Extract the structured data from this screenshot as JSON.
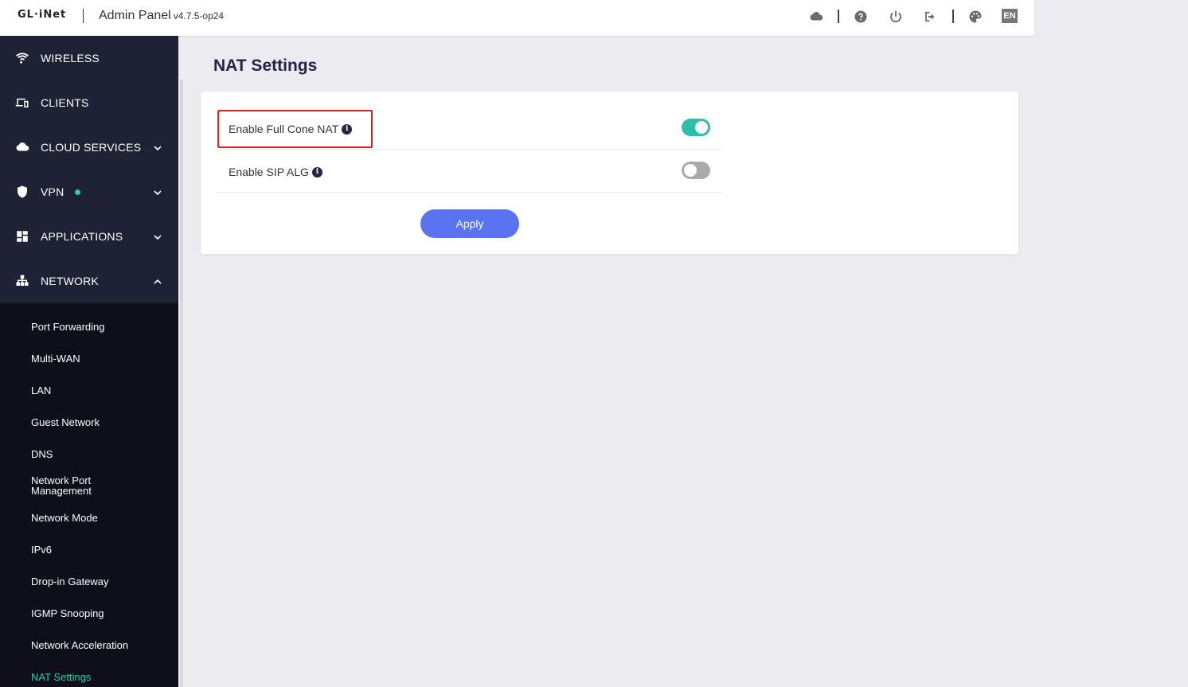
{
  "header": {
    "logo": "GL·iNet",
    "title": "Admin Panel",
    "version": "v4.7.5-op24",
    "language": "EN",
    "icons": [
      "cloud-icon",
      "help-icon",
      "power-icon",
      "logout-icon",
      "palette-icon"
    ]
  },
  "sidebar": {
    "items": [
      {
        "label": "WIRELESS",
        "icon": "wifi-icon"
      },
      {
        "label": "CLIENTS",
        "icon": "devices-icon"
      },
      {
        "label": "CLOUD SERVICES",
        "icon": "cloud-icon"
      },
      {
        "label": "VPN",
        "icon": "shield-icon"
      },
      {
        "label": "APPLICATIONS",
        "icon": "apps-grid-icon"
      },
      {
        "label": "NETWORK",
        "icon": "network-icon"
      }
    ],
    "submenu": [
      "Port Forwarding",
      "Multi-WAN",
      "LAN",
      "Guest Network",
      "DNS",
      "Network Port Management",
      "Network Mode",
      "IPv6",
      "Drop-in Gateway",
      "IGMP Snooping",
      "Network Acceleration",
      "NAT Settings"
    ],
    "active_submenu": "NAT Settings",
    "vpn_status_color": "#35c9a7"
  },
  "main": {
    "page_title": "NAT Settings",
    "settings": [
      {
        "label": "Enable Full Cone NAT",
        "enabled": true
      },
      {
        "label": "Enable SIP ALG",
        "enabled": false
      }
    ],
    "apply_label": "Apply",
    "info_glyph": "i"
  },
  "colors": {
    "accent": "#2cbfa6",
    "primary_button": "#5a73f1",
    "sidebar_bg": "#1f2235",
    "highlight": "#e02020"
  }
}
